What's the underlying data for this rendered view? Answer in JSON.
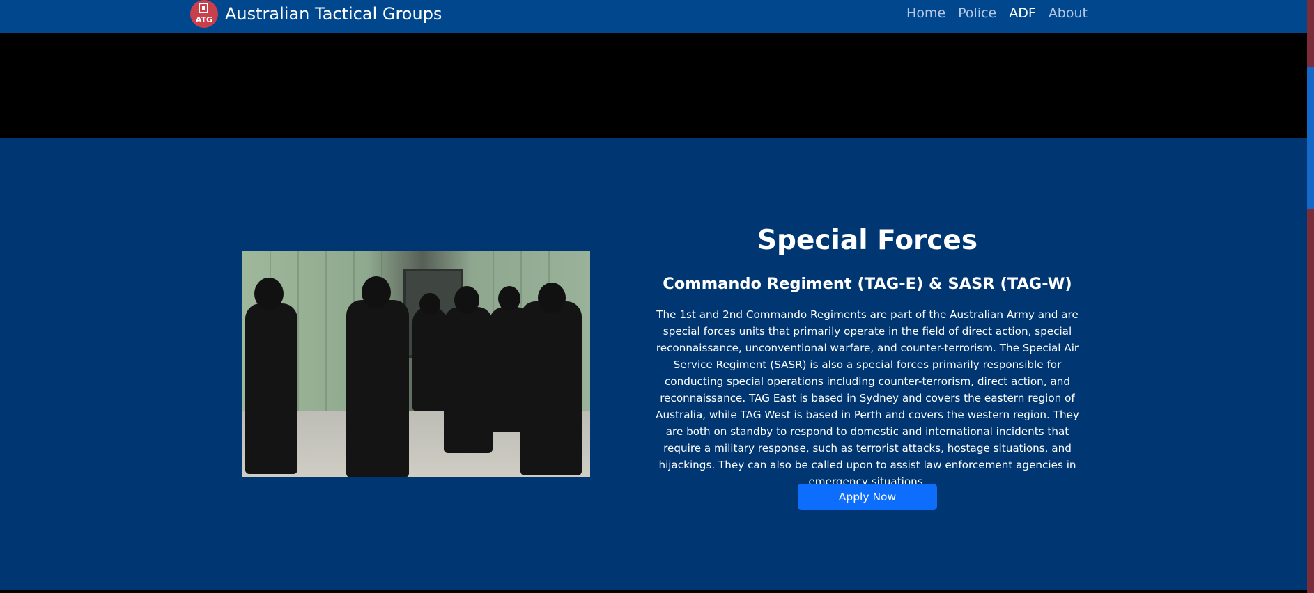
{
  "navbar": {
    "logo_abbr": "ATG",
    "brand": "Australian Tactical Groups",
    "links": [
      {
        "label": "Home",
        "active": false
      },
      {
        "label": "Police",
        "active": false
      },
      {
        "label": "ADF",
        "active": true
      },
      {
        "label": "About",
        "active": false
      }
    ]
  },
  "section": {
    "title": "Special Forces",
    "subtitle": "Commando Regiment (TAG-E) & SASR (TAG-W)",
    "description": "The 1st and 2nd Commando Regiments are part of the Australian Army and are special forces units that primarily operate in the field of direct action, special reconnaissance, unconventional warfare, and counter-terrorism. The Special Air Service Regiment (SASR) is also a special forces primarily responsible for conducting special operations including counter-terrorism, direct action, and reconnaissance. TAG East is based in Sydney and covers the eastern region of Australia, while TAG West is based in Perth and covers the western region. They are both on standby to respond to domestic and international incidents that require a military response, such as terrorist attacks, hostage situations, and hijackings. They can also be called upon to assist law enforcement agencies in emergency situations.",
    "button": "Apply Now"
  },
  "colors": {
    "navbar": "#00478e",
    "section_bg": "#003671",
    "button": "#0d6efd",
    "logo": "#c9404d"
  }
}
